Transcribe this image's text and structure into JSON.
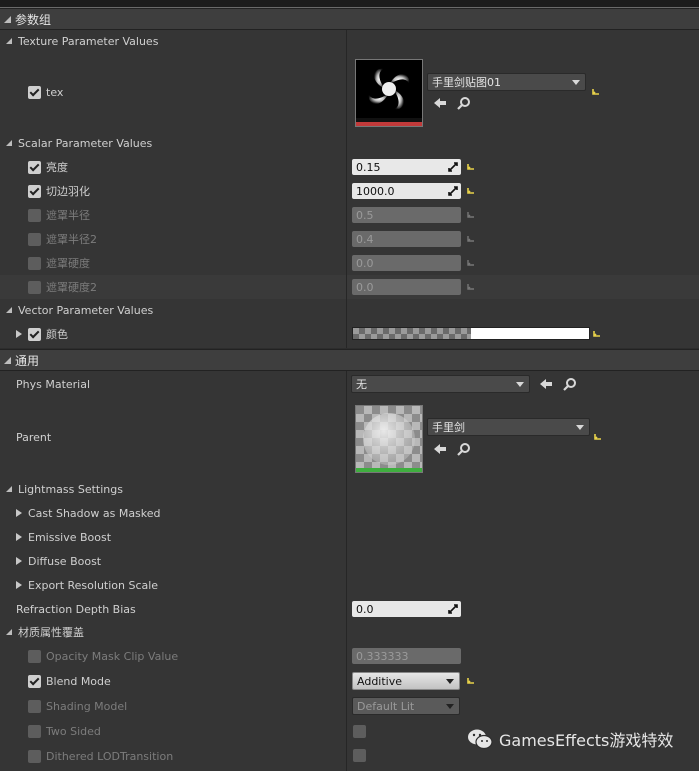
{
  "param_group": {
    "title": "参数组",
    "texture_section": {
      "title": "Texture Parameter Values",
      "tex": {
        "label": "tex",
        "checked": true,
        "asset": "手里剑贴图01"
      }
    },
    "scalar_section": {
      "title": "Scalar Parameter Values",
      "params": [
        {
          "label": "亮度",
          "value": "0.15",
          "enabled": true
        },
        {
          "label": "切边羽化",
          "value": "1000.0",
          "enabled": true
        },
        {
          "label": "遮罩半径",
          "value": "0.5",
          "enabled": false
        },
        {
          "label": "遮罩半径2",
          "value": "0.4",
          "enabled": false
        },
        {
          "label": "遮罩硬度",
          "value": "0.0",
          "enabled": false
        },
        {
          "label": "遮罩硬度2",
          "value": "0.0",
          "enabled": false
        }
      ]
    },
    "vector_section": {
      "title": "Vector Parameter Values",
      "color": {
        "label": "颜色",
        "checked": true
      }
    }
  },
  "general": {
    "title": "通用",
    "phys_material": {
      "label": "Phys Material",
      "value": "无"
    },
    "parent": {
      "label": "Parent",
      "asset": "手里剑"
    },
    "lightmass": {
      "title": "Lightmass Settings",
      "items": [
        "Cast Shadow as Masked",
        "Emissive Boost",
        "Diffuse Boost",
        "Export Resolution Scale"
      ]
    },
    "refraction": {
      "label": "Refraction Depth Bias",
      "value": "0.0"
    },
    "material_override": {
      "title": "材质属性覆盖",
      "opacity_clip": {
        "label": "Opacity Mask Clip Value",
        "value": "0.333333"
      },
      "blend_mode": {
        "label": "Blend Mode",
        "value": "Additive"
      },
      "shading_model": {
        "label": "Shading Model",
        "value": "Default Lit"
      },
      "two_sided": {
        "label": "Two Sided"
      },
      "dithered": {
        "label": "Dithered LODTransition"
      }
    }
  },
  "watermark": {
    "text": "GamesEffects游戏特效"
  },
  "colors": {
    "accent_yellow": "#e8d24a",
    "texture_bar": "#c23a3a",
    "parent_bar": "#3fae3f"
  }
}
